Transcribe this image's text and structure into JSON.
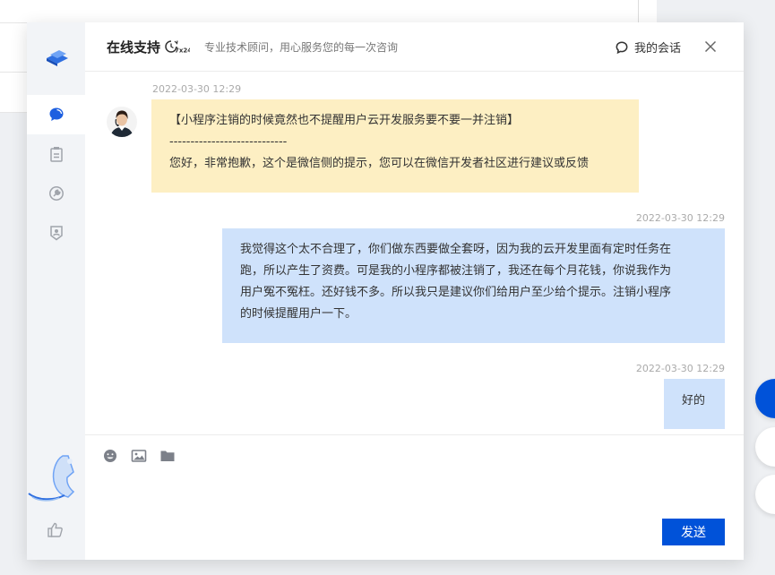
{
  "header": {
    "title": "在线支持",
    "subtitle": "专业技术顾问，用心服务您的每一次咨询",
    "my_sessions_label": "我的会话",
    "badge_icon": "7x24-service-icon",
    "close_icon": "close-icon"
  },
  "sidebar": {
    "items": [
      {
        "icon": "chat-icon",
        "active": true
      },
      {
        "icon": "clipboard-icon",
        "active": false
      },
      {
        "icon": "tool-icon",
        "active": false
      },
      {
        "icon": "shield-user-icon",
        "active": false
      }
    ],
    "bottom_icon": "thumbs-up-icon"
  },
  "messages": [
    {
      "timestamp": "2022-03-30 12:29",
      "from": "agent",
      "lines": [
        "【小程序注销的时候竟然也不提醒用户云开发服务要不要一并注销】",
        "----------------------------",
        "您好，非常抱歉，这个是微信侧的提示，您可以在微信开发者社区进行建议或反馈"
      ]
    },
    {
      "timestamp": "2022-03-30 12:29",
      "from": "user",
      "lines": [
        "我觉得这个太不合理了，你们做东西要做全套呀，因为我的云开发里面有定时任务在",
        "跑，所以产生了资费。可是我的小程序都被注销了，我还在每个月花钱，你说我作为",
        "用户冤不冤枉。还好钱不多。所以我只是建议你们给用户至少给个提示。注销小程序",
        "的时候提醒用户一下。"
      ]
    },
    {
      "timestamp": "2022-03-30 12:29",
      "from": "user",
      "lines": [
        "好的"
      ]
    }
  ],
  "composer": {
    "tools": [
      "emoji-icon",
      "image-icon",
      "folder-icon"
    ],
    "send_label": "发送"
  },
  "colors": {
    "accent": "#0052d9",
    "agent_bubble": "#fdefc3",
    "user_bubble": "#cfe2fb"
  }
}
